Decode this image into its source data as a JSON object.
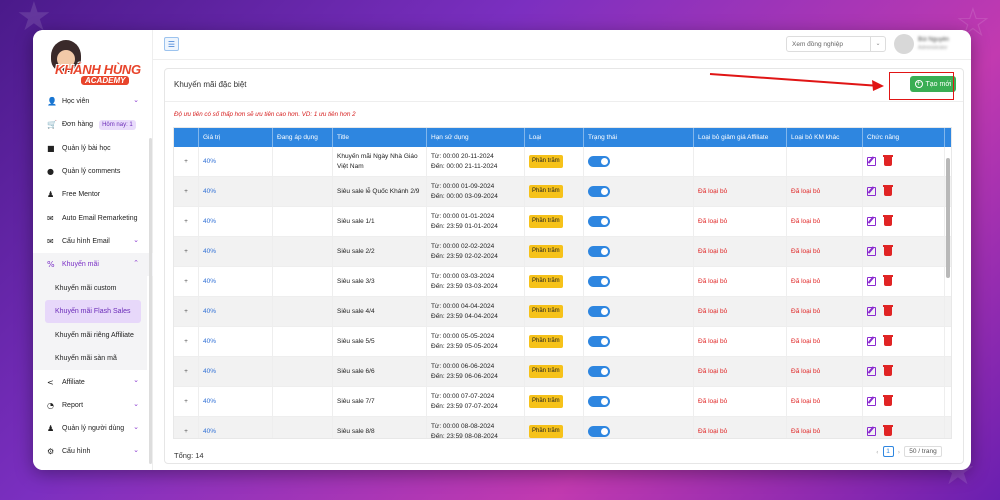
{
  "app": {
    "logo_text": "KHÁNH HÙNG",
    "logo_sub": "ACADEMY"
  },
  "sidebar": {
    "items": [
      {
        "label": "Học viên",
        "icon": "student-icon",
        "chevron": true
      },
      {
        "label": "Đơn hàng",
        "icon": "cart-icon",
        "badge": "Hôm nay: 1"
      },
      {
        "label": "Quản lý bài học",
        "icon": "video-icon"
      },
      {
        "label": "Quản lý comments",
        "icon": "comment-icon"
      },
      {
        "label": "Free Mentor",
        "icon": "mentor-icon"
      },
      {
        "label": "Auto Email Remarketing",
        "icon": "email-auto-icon"
      },
      {
        "label": "Cấu hình Email",
        "icon": "mail-icon",
        "chevron": true
      },
      {
        "label": "Khuyến mãi",
        "icon": "promo-icon",
        "chevron": true,
        "expanded": true
      }
    ],
    "promo_sub": [
      {
        "label": "Khuyến mãi custom"
      },
      {
        "label": "Khuyến mãi Flash Sales",
        "active": true
      },
      {
        "label": "Khuyến mãi riêng Affiliate"
      },
      {
        "label": "Khuyến mãi sàn mã"
      }
    ],
    "items_bottom": [
      {
        "label": "Affiliate",
        "icon": "share-icon",
        "chevron": true
      },
      {
        "label": "Report",
        "icon": "chart-pie-icon",
        "chevron": true
      },
      {
        "label": "Quản lý người dùng",
        "icon": "users-icon",
        "chevron": true
      },
      {
        "label": "Cấu hình",
        "icon": "gear-icon",
        "chevron": true
      }
    ]
  },
  "topbar": {
    "colleague_placeholder": "Xem đồng nghiệp",
    "user_name": "Bùi Nguyễn",
    "user_sub": "Administrator"
  },
  "page": {
    "title": "Khuyến mãi đặc biệt",
    "create_label": "Tạo mới",
    "note": "Độ ưu tiên có số thấp hơn sẽ ưu tiên cao hơn. VD: 1 ưu tiên hơn 2",
    "total": "Tổng: 14",
    "current_page": "1",
    "page_size": "50 / trang"
  },
  "table": {
    "headers": [
      "",
      "Giá trị",
      "Đang áp dụng",
      "Title",
      "Hạn sử dụng",
      "Loại",
      "Trạng thái",
      "Loại bỏ giảm giá Affiliate",
      "Loại bỏ KM khác",
      "Chức năng"
    ],
    "rows": [
      {
        "value": "40%",
        "title": "Khuyến mãi Ngày Nhà Giáo Việt Nam",
        "from": "Từ: 00:00 20-11-2024",
        "to": "Đến: 00:00 21-11-2024",
        "type": "Phần trăm",
        "status_on": true,
        "remove_aff": "",
        "remove_other": ""
      },
      {
        "value": "40%",
        "title": "Siêu sale lễ Quốc Khánh 2/9",
        "from": "Từ: 00:00 01-09-2024",
        "to": "Đến: 00:00 03-09-2024",
        "type": "Phần trăm",
        "status_on": true,
        "remove_aff": "Đã loại bỏ",
        "remove_other": "Đã loại bỏ"
      },
      {
        "value": "40%",
        "title": "Siêu sale 1/1",
        "from": "Từ: 00:00 01-01-2024",
        "to": "Đến: 23:59 01-01-2024",
        "type": "Phần trăm",
        "status_on": true,
        "remove_aff": "Đã loại bỏ",
        "remove_other": "Đã loại bỏ"
      },
      {
        "value": "40%",
        "title": "Siêu sale 2/2",
        "from": "Từ: 00:00 02-02-2024",
        "to": "Đến: 23:59 02-02-2024",
        "type": "Phần trăm",
        "status_on": true,
        "remove_aff": "Đã loại bỏ",
        "remove_other": "Đã loại bỏ"
      },
      {
        "value": "40%",
        "title": "Siêu sale 3/3",
        "from": "Từ: 00:00 03-03-2024",
        "to": "Đến: 23:59 03-03-2024",
        "type": "Phần trăm",
        "status_on": true,
        "remove_aff": "Đã loại bỏ",
        "remove_other": "Đã loại bỏ"
      },
      {
        "value": "40%",
        "title": "Siêu sale 4/4",
        "from": "Từ: 00:00 04-04-2024",
        "to": "Đến: 23:59 04-04-2024",
        "type": "Phần trăm",
        "status_on": true,
        "remove_aff": "Đã loại bỏ",
        "remove_other": "Đã loại bỏ"
      },
      {
        "value": "40%",
        "title": "Siêu sale 5/5",
        "from": "Từ: 00:00 05-05-2024",
        "to": "Đến: 23:59 05-05-2024",
        "type": "Phần trăm",
        "status_on": true,
        "remove_aff": "Đã loại bỏ",
        "remove_other": "Đã loại bỏ"
      },
      {
        "value": "40%",
        "title": "Siêu sale 6/6",
        "from": "Từ: 00:00 06-06-2024",
        "to": "Đến: 23:59 06-06-2024",
        "type": "Phần trăm",
        "status_on": true,
        "remove_aff": "Đã loại bỏ",
        "remove_other": "Đã loại bỏ"
      },
      {
        "value": "40%",
        "title": "Siêu sale 7/7",
        "from": "Từ: 00:00 07-07-2024",
        "to": "Đến: 23:59 07-07-2024",
        "type": "Phần trăm",
        "status_on": true,
        "remove_aff": "Đã loại bỏ",
        "remove_other": "Đã loại bỏ"
      },
      {
        "value": "40%",
        "title": "Siêu sale 8/8",
        "from": "Từ: 00:00 08-08-2024",
        "to": "Đến: 23:59 08-08-2024",
        "type": "Phần trăm",
        "status_on": true,
        "remove_aff": "Đã loại bỏ",
        "remove_other": "Đã loại bỏ"
      }
    ]
  },
  "colors": {
    "accent": "#2e86e0",
    "brand_purple": "#7a2fc6",
    "create_green": "#3aae54",
    "danger": "#e02424",
    "tag_yellow": "#f6c21a"
  }
}
